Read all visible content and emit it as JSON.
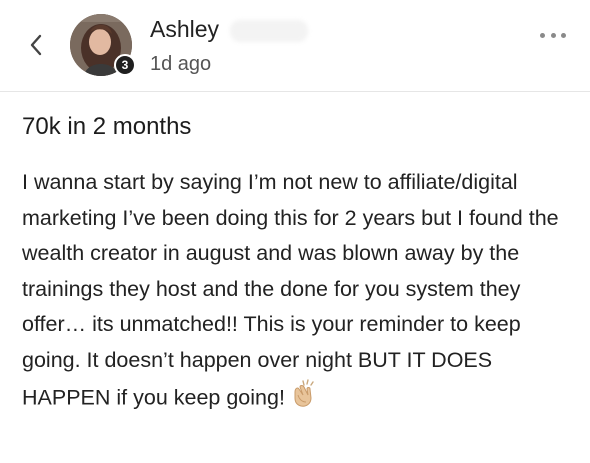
{
  "header": {
    "back_icon": "chevron-left-icon",
    "author_name": "Ashley",
    "level": "3",
    "time_ago": "1d ago",
    "more_icon": "more-horizontal-icon"
  },
  "post": {
    "title": "70k in 2 months",
    "body": "I wanna start by saying I’m not new to affiliate/digital marketing I’ve been doing this for 2 years but I found the wealth creator in august and was blown away by the trainings they host and the done for you system they offer… its unmatched!! This is your reminder to keep going. It doesn’t happen over night BUT IT DOES HAPPEN if you keep going!",
    "emoji_icon": "clapping-hands-icon"
  },
  "colors": {
    "badge": "#1f1f1f",
    "divider": "#e6e6e6",
    "muted_text": "#555555"
  }
}
